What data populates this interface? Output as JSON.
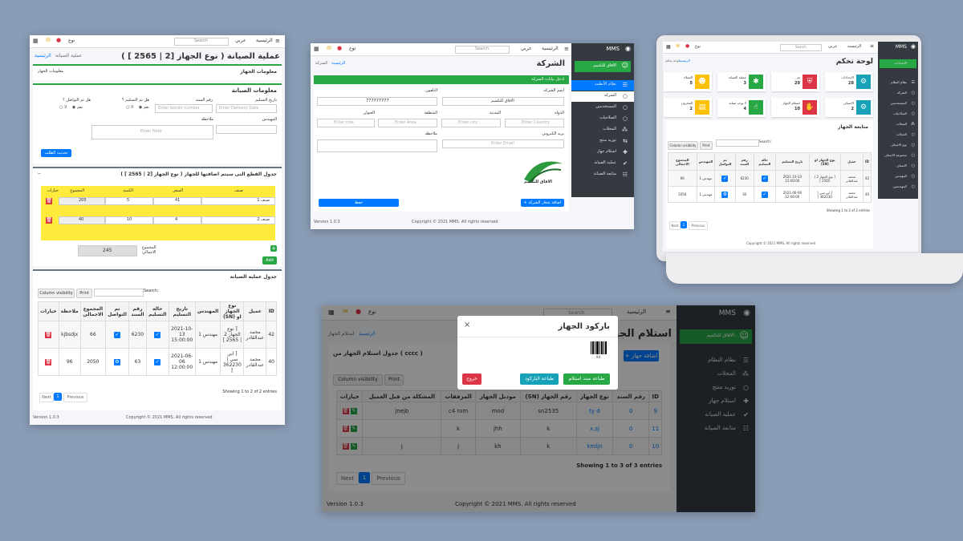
{
  "s1": {
    "brand": "نوع",
    "lang": "عربي",
    "search": "Search",
    "home": "الرئيسية",
    "title": "عملية الصيانة ( نوع الجهاز [2 | 2565 ] )",
    "breadcrumb_home": "الرئيسية",
    "breadcrumb_current": "عملية الصيانة",
    "device_info": "معلومات الجهاز",
    "device_info_btn": "معلومات الجهاز",
    "maint_info": "معلومات الصيانة",
    "delivery_date": "تاريخ التسليم",
    "bond_no": "رقم السند",
    "delivered_q": "هل تم التسليم ؟",
    "contacted_q": "هل تم التواصل ؟",
    "yes": "نعم",
    "no": "لا",
    "delivery_ph": "Enter Delivery Date",
    "bond_ph": "Enter bondn number",
    "engineer": "المهندس",
    "note": "ملاحظة",
    "note_ph": "Enter Note",
    "update_btn": "تحديث الطلب",
    "parts_title": "جدول القطع التى سيتم اضافتها للجهاز ( نوع الجهاز [2 | 2565 ] )",
    "parts_headers": [
      "صنف",
      "السعر",
      "الكمية",
      "المجموع",
      "خيارات"
    ],
    "parts_rows": [
      {
        "item": "صنف 1",
        "price": "41",
        "qty": "5",
        "total": "205"
      },
      {
        "item": "صنف 2",
        "price": "4",
        "qty": "10",
        "total": "40"
      }
    ],
    "grand_total_label": "المجموع الاجمالي",
    "grand_total": "245",
    "add_btn": "Add",
    "table_title": "جدول عملية الصيانة",
    "colvis": "Column visibility",
    "print": "Print",
    "search_label": "Search:",
    "headers": [
      "ID",
      "عميل",
      "نوع الجهاز او (SN)",
      "المهندس",
      "تاريخ التسليم",
      "حالة التسليم",
      "رقم السند",
      "تم التواصل",
      "المجموع الاجمالي",
      "ملاحظة",
      "خيارات"
    ],
    "rows": [
      {
        "id": "42",
        "client": "محمد عبدالقادر",
        "device": "[ نوع الجهاز 2 | 2565 ]",
        "eng": "مهندس 1",
        "date": "2021-10-13 15:00:00",
        "bond": "6230",
        "total": "66",
        "note": "kjbsdjx"
      },
      {
        "id": "40",
        "client": "محمد عبدالقادر",
        "device": "[ ابي سي | 362230 ]",
        "eng": "مهندس 1",
        "date": "2021-06-06 12:00:00",
        "bond": "63",
        "total": "2050",
        "note": "96"
      }
    ],
    "entries": "Showing 1 to 2 of 2 entries",
    "next": "Next",
    "page": "1",
    "prev": "Previous",
    "version": "Version 1.0.3",
    "copyright": "Copyright © 2021 MMS. All rights reserved"
  },
  "s2": {
    "brand": "نوع",
    "lang": "عربي",
    "search": "Search",
    "home": "الرئيسية",
    "mms": "MMS",
    "user": "الافاق للتكميم",
    "title": "الشركة",
    "breadcrumb_home": "الرئيسية",
    "breadcrumb_current": "الشركة",
    "form_title": "ادخل بيانات الشركة",
    "company_name": "اسم الشركة",
    "company_value": "الافاق للتكميم",
    "phone": "التلفون",
    "phone_value": "777777777",
    "country": "الدولة",
    "city": "المدينة",
    "region": "المنطقة",
    "address": "العنوان",
    "country_ph": "Enter Country",
    "city_ph": "Enter city",
    "region_ph": "Enter Area",
    "address_ph": "Enter title",
    "email": "بريد الكتروني",
    "email_ph": "Enter Email",
    "note": "ملاحظة",
    "logo_btn": "+ اضافة شعار الشركة",
    "save_btn": "حفظ",
    "logo_text": "الافاق للتكميم",
    "menu": [
      "نظام الأنظمة",
      "الشركة",
      "المستخدمين",
      "الصلاحيات",
      "المحلات",
      "توريد منتج",
      "استلام جهاز",
      "عملية الصيانة",
      "متابعة الصيانة"
    ],
    "version": "Version 1.0.3",
    "copyright": "Copyright © 2021 MMS. All rights reserved"
  },
  "s3": {
    "brand": "نوع",
    "lang": "عربي",
    "search": "Search",
    "home": "الرئيسية",
    "mms": "MMS",
    "title": "لوحة تحكم",
    "breadcrumb_home": "الرئيسية",
    "breadcrumb_current": "لوحة تحكم",
    "cards": [
      {
        "label": "الاعدادات",
        "value": "28",
        "color": "#17a2b8",
        "icon": "gear-icon"
      },
      {
        "label": "تم",
        "value": "29",
        "color": "#dc3545",
        "icon": "shield-icon"
      },
      {
        "label": "عملية الصيانة",
        "value": "3",
        "color": "#28a745",
        "icon": "wrench-icon"
      },
      {
        "label": "العملاء",
        "value": "5",
        "color": "#ffc107",
        "icon": "users-icon"
      },
      {
        "label": "الاصناف",
        "value": "2",
        "color": "#17a2b8",
        "icon": "gear-icon"
      },
      {
        "label": "استلام الجهاز",
        "value": "10",
        "color": "#dc3545",
        "icon": "hand-icon"
      },
      {
        "label": "لا يوجد صيانة",
        "value": "4",
        "color": "#28a745",
        "icon": "thumb-icon"
      },
      {
        "label": "المخزون",
        "value": "2",
        "color": "#ffc107",
        "icon": "box-icon"
      }
    ],
    "follow_title": "متابعة الجهاز",
    "colvis": "Column visibility",
    "print": "Print",
    "search_label": "Search:",
    "headers": [
      "ID",
      "عميل",
      "نوع الجهاز او (SN)",
      "تاريخ التسليم",
      "حالة التسليم",
      "رقم السند",
      "تم التواصل",
      "المهندس",
      "المجموع الاجمالي"
    ],
    "rows": [
      {
        "id": "42",
        "client": "محمد عبدالقادر",
        "device": "[ نوع الجهاز 2 | 2565 ]",
        "date": "2021-10-13 15:00:00",
        "bond": "6230",
        "eng": "مهندس 1",
        "total": "66"
      },
      {
        "id": "40",
        "client": "محمد عبدالقادر",
        "device": "[ ابي سي | 362230 ]",
        "date": "2021-06-06 12:00:00",
        "bond": "30",
        "eng": "مهندس 1",
        "total": "2050"
      }
    ],
    "entries": "Showing 1 to 2 of 2 entries",
    "next": "Next",
    "page": "1",
    "prev": "Previous",
    "menu": [
      "الاعدادات",
      "نظام النظام",
      "الشركة",
      "المستخدمين",
      "الصلاحيات",
      "المحلات",
      "المحلات",
      "نوع الاصناف",
      "مجموعة الاصناف",
      "الاصناف",
      "المهندس",
      "المهندسين"
    ],
    "copyright": "Copyright © 2021 MMS. All rights reserved"
  },
  "s4": {
    "brand": "نوع",
    "search": "Search",
    "home": "الرئيسية",
    "mms": "MMS",
    "user": "الافاق للتكميم",
    "title": "استلام الجهاز",
    "breadcrumb_home": "الرئيسية",
    "breadcrumb_current": "استلام الجهاز",
    "add_btn": "+ اضافة جهاز",
    "table_title": "جدول استلام الجهاز من ( cccc )",
    "colvis": "Column visibility",
    "print": "Print",
    "headers": [
      "ID",
      "رقم السند",
      "نوع الجهاز",
      "رقم الجهاز (SN)",
      "موديل الجهاز",
      "المرفقات",
      "المشكلة من قبل العميل",
      "خيارات"
    ],
    "rows": [
      {
        "id": "9",
        "bond": "0",
        "type": "ty d",
        "sn": "sn2535",
        "model": "mod",
        "att": "c4 rom",
        "problem": "jnejb"
      },
      {
        "id": "11",
        "bond": "0",
        "type": "x,sj",
        "sn": "k",
        "model": "jhh",
        "att": "k",
        "problem": ""
      },
      {
        "id": "10",
        "bond": "0",
        "type": "kmljn",
        "sn": "k",
        "model": "kh",
        "att": "j",
        "problem": "j"
      }
    ],
    "entries": "Showing 1 to 3 of 3 entries",
    "next": "Next",
    "page": "1",
    "prev": "Previous",
    "menu": [
      "نظام النظام",
      "المحلات",
      "توريد منتج",
      "استلام جهاز",
      "عملية الصيانة",
      "متابعة الصيانة"
    ],
    "modal_title": "باركود الجهاز",
    "barcode_num": "94",
    "print_receipt": "طباعة سند استلام",
    "print_barcode": "طباعة الباركود",
    "exit": "خروج",
    "version": "Version 1.0.3",
    "copyright": "Copyright © 2021 MMS. All rights reserved"
  }
}
